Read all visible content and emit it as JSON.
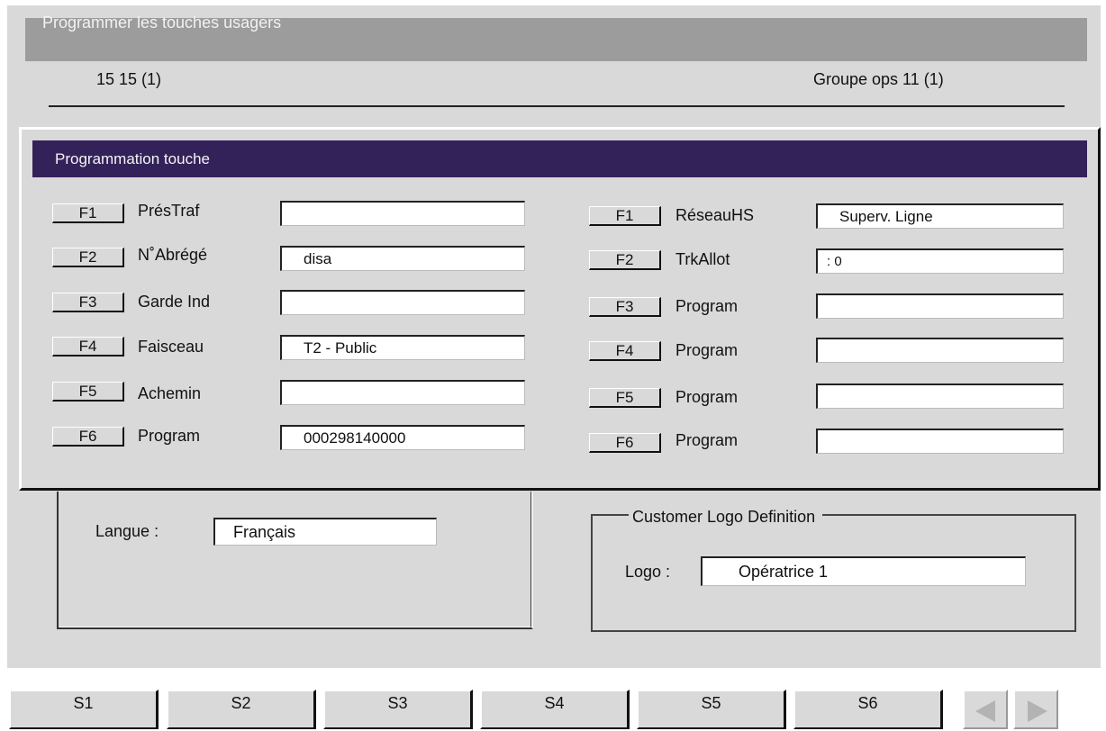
{
  "window": {
    "title": "Programmer les touches usagers",
    "subheader_left": "15 15 (1)",
    "subheader_right": "Groupe ops 11 (1)"
  },
  "dialog": {
    "title": "Programmation touche",
    "left_keys": [
      {
        "key": "F1",
        "label": "PrésTraf",
        "value": ""
      },
      {
        "key": "F2",
        "label": "N˚Abrégé",
        "value": "disa"
      },
      {
        "key": "F3",
        "label": "Garde Ind",
        "value": ""
      },
      {
        "key": "F4",
        "label": "Faisceau",
        "value": "T2 - Public"
      },
      {
        "key": "F5",
        "label": "Achemin",
        "value": ""
      },
      {
        "key": "F6",
        "label": "Program",
        "value": "000298140000"
      }
    ],
    "right_keys": [
      {
        "key": "F1",
        "label": "RéseauHS",
        "value": "Superv. Ligne"
      },
      {
        "key": "F2",
        "label": "TrkAllot",
        "value": ": 0"
      },
      {
        "key": "F3",
        "label": "Program",
        "value": ""
      },
      {
        "key": "F4",
        "label": "Program",
        "value": ""
      },
      {
        "key": "F5",
        "label": "Program",
        "value": ""
      },
      {
        "key": "F6",
        "label": "Program",
        "value": ""
      }
    ]
  },
  "language": {
    "label": "Langue :",
    "value": "Français"
  },
  "logo": {
    "group_title": "Customer Logo Definition",
    "label": "Logo :",
    "value": "Opératrice 1"
  },
  "softkeys": [
    "S1",
    "S2",
    "S3",
    "S4",
    "S5",
    "S6"
  ],
  "nav": {
    "prev_icon": "left-arrow-icon",
    "next_icon": "right-arrow-icon"
  },
  "colors": {
    "background": "#d9d9d9",
    "title_bar": "#9c9c9c",
    "dialog_header": "#33225a",
    "field_bg": "#ffffff"
  }
}
